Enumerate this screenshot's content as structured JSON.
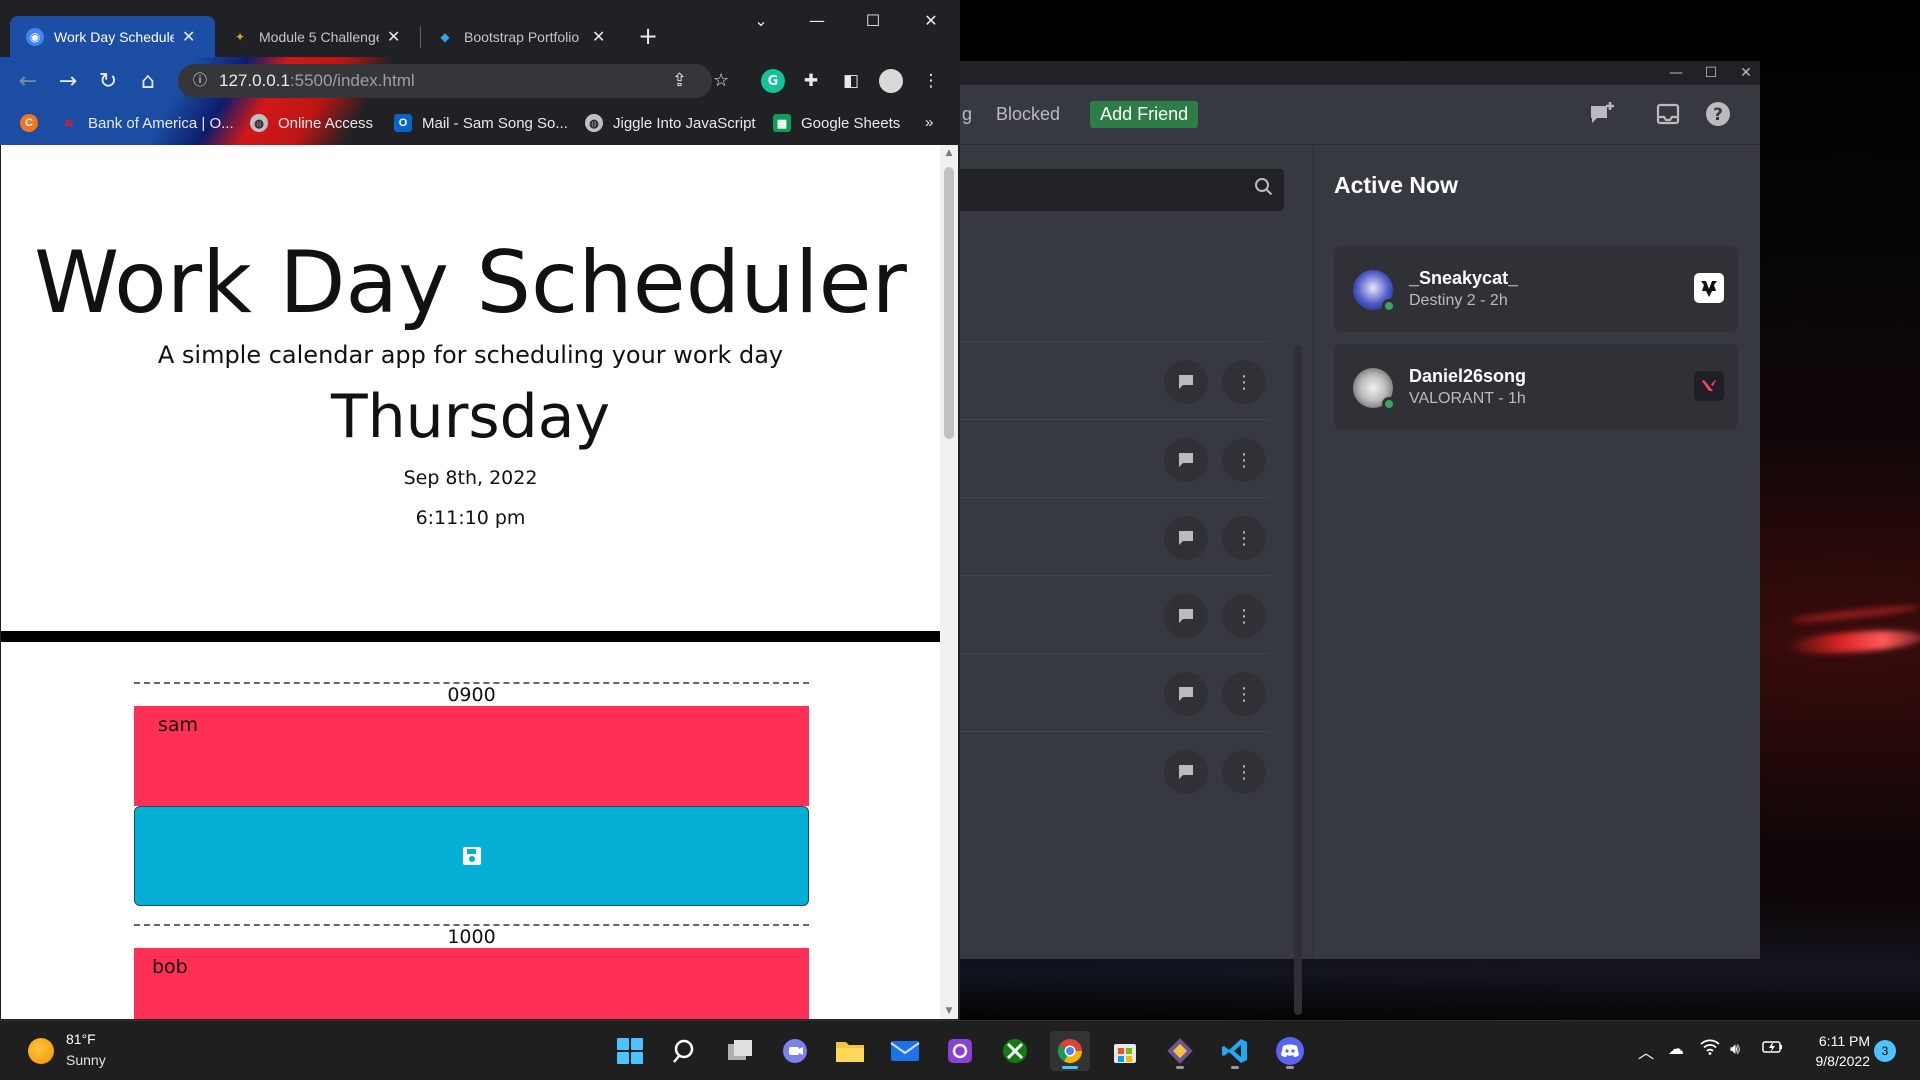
{
  "browser": {
    "tabs": [
      {
        "label": "Work Day Scheduler",
        "active": true
      },
      {
        "label": "Module 5 Challenge",
        "active": false
      },
      {
        "label": "Bootstrap Portfolio",
        "active": false
      }
    ],
    "url_host": "127.0.0.1",
    "url_path": ":5500/index.html",
    "bookmarks": [
      {
        "label": "Bank of America | O..."
      },
      {
        "label": "Online Access"
      },
      {
        "label": "Mail - Sam Song So..."
      },
      {
        "label": "Jiggle Into JavaScript"
      },
      {
        "label": "Google Sheets"
      }
    ],
    "more_bookmarks": "»"
  },
  "page": {
    "title": "Work Day Scheduler",
    "subtitle": "A simple calendar app for scheduling your work day",
    "day": "Thursday",
    "date": "Sep 8th, 2022",
    "time": "6:11:10 pm",
    "hours": [
      {
        "label": "0900",
        "event": "sam"
      },
      {
        "label": "1000",
        "event": "bob"
      }
    ]
  },
  "discord": {
    "tabs": {
      "partial": "g",
      "blocked": "Blocked",
      "add_friend": "Add Friend"
    },
    "active_now_title": "Active Now",
    "active_now": [
      {
        "name": "_Sneakycat_",
        "activity": "Destiny 2 - 2h",
        "game_icon": "destiny-icon"
      },
      {
        "name": "Daniel26song",
        "activity": "VALORANT - 1h",
        "game_icon": "valorant-icon"
      }
    ],
    "friend_rows": 6
  },
  "taskbar": {
    "weather_temp": "81°F",
    "weather_cond": "Sunny",
    "clock_time": "6:11 PM",
    "clock_date": "9/8/2022",
    "notifications": "3"
  },
  "colors": {
    "event_bg": "#ff2f55",
    "save_btn": "#06afd6",
    "discord_green": "#2d7d46",
    "online": "#3ba55c"
  }
}
